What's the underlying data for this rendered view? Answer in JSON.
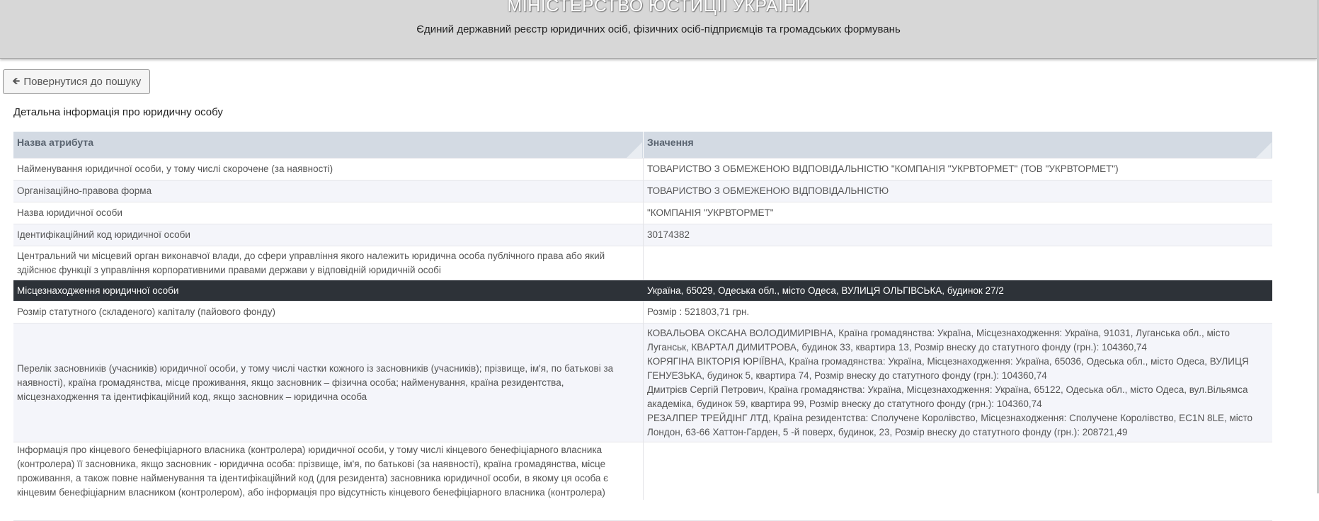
{
  "header": {
    "ministry": "МІНІСТЕРСТВО ЮСТИЦІЇ УКРАЇНИ",
    "registry": "Єдиний державний реєстр юридичних осіб, фізичних осіб-підприємців та громадських формувань"
  },
  "back_button": {
    "icon": "arrow-left-icon",
    "label": "Повернутися до пошуку"
  },
  "section_title": "Детальна інформація про юридичну особу",
  "table": {
    "columns": [
      "Назва атрибута",
      "Значення"
    ],
    "rows": [
      {
        "attr": "Найменування юридичної особи, у тому числі скорочене (за наявності)",
        "value": "ТОВАРИСТВО З ОБМЕЖЕНОЮ ВІДПОВІДАЛЬНІСТЮ \"КОМПАНІЯ \"УКРВТОРМЕТ\" (ТОВ \"УКРВТОРМЕТ\")"
      },
      {
        "attr": "Організаційно-правова форма",
        "value": "ТОВАРИСТВО З ОБМЕЖЕНОЮ ВІДПОВІДАЛЬНІСТЮ"
      },
      {
        "attr": "Назва юридичної особи",
        "value": "\"КОМПАНІЯ \"УКРВТОРМЕТ\""
      },
      {
        "attr": "Ідентифікаційний код юридичної особи",
        "value": "30174382"
      },
      {
        "attr": "Центральний чи місцевий орган виконавчої влади, до сфери управління якого належить юридична особа публічного права або який здійснює функції з управління корпоративними правами держави у відповідній юридичній особі",
        "value": ""
      },
      {
        "attr": "Місцезнаходження юридичної особи",
        "value": "Україна, 65029, Одеська обл., місто Одеса, ВУЛИЦЯ ОЛЬГІВСЬКА, будинок 27/2"
      },
      {
        "attr": "Розмір статутного (складеного) капіталу (пайового фонду)",
        "value": "Розмір : 521803,71 грн."
      },
      {
        "attr": "Перелік засновників (учасників) юридичної особи, у тому числі частки кожного із засновників (учасників); прізвище, ім'я, по батькові за наявності), країна громадянства, місце проживання, якщо засновник – фізична особа; найменування, країна резидентства, місцезнаходження та ідентифікаційний код, якщо засновник – юридична особа",
        "founders": [
          "КОВАЛЬОВА ОКСАНА ВОЛОДИМИРІВНА, Країна громадянства: Україна, Місцезнаходження: Україна, 91031, Луганська обл., місто Луганськ, КВАРТАЛ ДИМИТРОВА, будинок 33, квартира 13, Розмір внеску до статутного фонду (грн.): 104360,74",
          "КОРЯГІНА ВІКТОРІЯ ЮРІЇВНА, Країна громадянства: Україна, Місцезнаходження: Україна, 65036, Одеська обл., місто Одеса, ВУЛИЦЯ ГЕНУЕЗЬКА, будинок 5, квартира 74, Розмір внеску до статутного фонду (грн.): 104360,74",
          "Дмитрієв Сергій Петрович, Країна громадянства: Україна, Місцезнаходження: Україна, 65122, Одеська обл., місто Одеса, вул.Вільямса академіка, будинок 59, квартира 99, Розмір внеску до статутного фонду (грн.): 104360,74",
          "РЕЗАЛПЕР ТРЕЙДІНГ ЛТД, Країна резидентства: Сполучене Королівство, Місцезнаходження: Сполучене Королівство, EC1N 8LE, місто Лондон, 63-66 Хаттон-Гарден, 5 -й поверх, будинок, 23, Розмір внеску до статутного фонду (грн.): 208721,49"
        ]
      },
      {
        "attr": "Інформація про кінцевого бенефіціарного власника (контролера) юридичної особи, у тому числі кінцевого бенефіціарного власника (контролера) її засновника, якщо засновник - юридична особа: прізвище, ім'я, по батькові (за наявності), країна громадянства, місце проживання, а також повне найменування та ідентифікаційний код (для резидента) засновника юридичної особи, в якому ця особа є кінцевим бенефіціарним власником (контролером), або інформація про відсутність кінцевого бенефіціарного власника (контролера)",
        "value": ""
      }
    ]
  }
}
